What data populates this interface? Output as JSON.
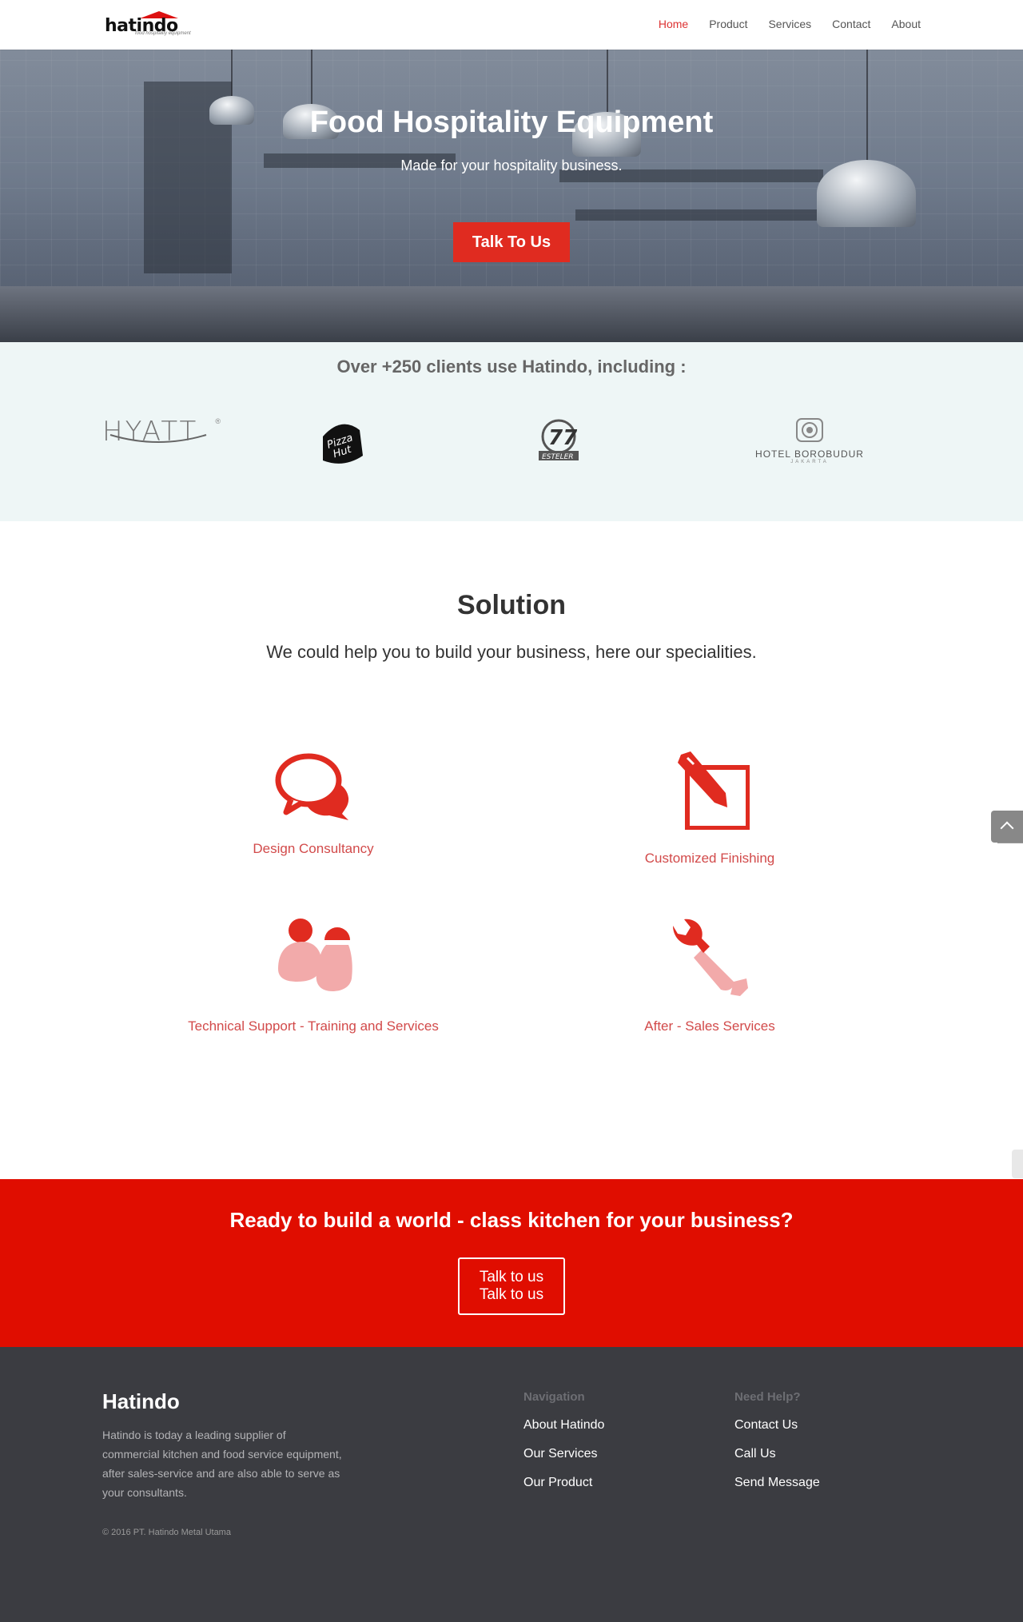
{
  "header": {
    "logo_text": "hatindo",
    "logo_tagline": "food hospitality equipment",
    "nav": [
      {
        "label": "Home",
        "active": true
      },
      {
        "label": "Product",
        "active": false
      },
      {
        "label": "Services",
        "active": false
      },
      {
        "label": "Contact",
        "active": false
      },
      {
        "label": "About",
        "active": false
      }
    ]
  },
  "hero": {
    "title": "Food Hospitality Equipment",
    "subtitle": "Made for your hospitality business.",
    "button_label": "Talk To Us"
  },
  "clients": {
    "title": "Over +250 clients use Hatindo, including :",
    "logos": [
      {
        "name": "HYATT"
      },
      {
        "name": "Pizza Hut"
      },
      {
        "name": "Es Teler 77"
      },
      {
        "name": "HOTEL BOROBUDUR",
        "sub": "JAKARTA"
      }
    ]
  },
  "solution": {
    "title": "Solution",
    "subtitle": "We could help you to build your business, here our specialities.",
    "features": [
      {
        "label": "Design Consultancy",
        "icon": "chat-bubbles-icon"
      },
      {
        "label": "Customized Finishing",
        "icon": "edit-pencil-icon"
      },
      {
        "label": "Technical Support - Training and Services",
        "icon": "people-icon"
      },
      {
        "label": "After - Sales Services",
        "icon": "wrench-icon"
      }
    ]
  },
  "cta": {
    "title": "Ready to build a world - class kitchen for your business?",
    "button_line1": "Talk to us",
    "button_line2": "Talk to us"
  },
  "footer": {
    "brand": "Hatindo",
    "description": "Hatindo is today a leading supplier of commercial kitchen and food service equipment, after sales-service and are also able to serve as your consultants.",
    "copyright": "© 2016 PT. Hatindo Metal Utama",
    "columns": [
      {
        "heading": "Navigation",
        "links": [
          "About Hatindo",
          "Our Services",
          "Our Product"
        ]
      },
      {
        "heading": "Need Help?",
        "links": [
          "Contact Us",
          "Call Us",
          "Send Message"
        ]
      }
    ]
  },
  "colors": {
    "accent": "#e02b20",
    "cta_background": "#e00d00",
    "footer_background": "#3b3c41",
    "clients_background": "#eef6f6"
  }
}
